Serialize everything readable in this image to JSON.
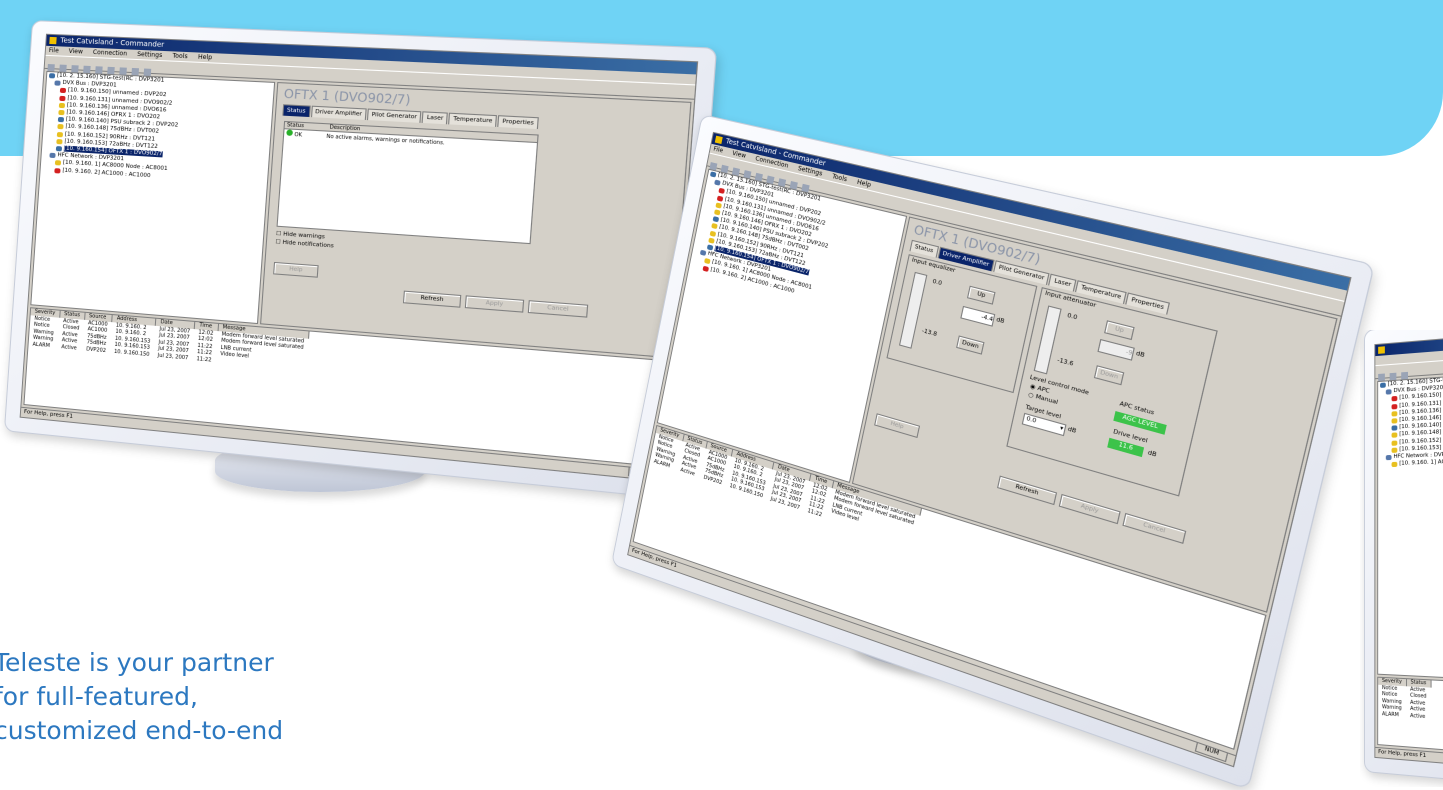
{
  "tagline": [
    "Teleste is your partner",
    "for full-featured,",
    "customized end-to-end"
  ],
  "colors": {
    "banner": "#6fd3f5",
    "tagline": "#2c78c0"
  },
  "app": {
    "title": "Test CatvIsland - Commander",
    "menu": [
      "File",
      "View",
      "Connection",
      "Settings",
      "Tools",
      "Help"
    ],
    "tree": [
      "[10. 2. 15.160] STG-test(RC : DVP3201",
      "DVX Bus : DVP3201",
      "[10. 9.160.150] unnamed : DVP202",
      "[10. 9.160.131] unnamed : DVO902/2",
      "[10. 9.160.136] unnamed : DVO616",
      "[10. 9.160.146] OFRX 1 : DVO202",
      "[10. 9.160.140] PSU subrack 2 : DVP202",
      "[10. 9.160.148] 75dBHz : DVT002",
      "[10. 9.160.152] 90RHz : DVT121",
      "[10. 9.160.153] 72aBHz : DVT122",
      "[10. 9.160.154] OFTX 1 : DVO902/7",
      "HFC Network : DVP3201",
      "[10. 9.160. 1] AC8000 Node : AC8001",
      "[10. 9.160. 2] AC1000 : AC1000"
    ],
    "panel_title": "OFTX 1 (DVO902/7)",
    "tabs": [
      "Status",
      "Driver Amplifier",
      "Pilot Generator",
      "Laser",
      "Temperature",
      "Properties"
    ],
    "status_columns": [
      "Status",
      "Description"
    ],
    "status_ok": "OK",
    "status_desc": "No active alarms, warnings or notifications.",
    "hide_warnings": "Hide warnings",
    "hide_notifications": "Hide notifications",
    "buttons": {
      "help": "Help",
      "refresh": "Refresh",
      "apply": "Apply",
      "cancel": "Cancel",
      "up": "Up",
      "down": "Down"
    },
    "amp": {
      "input_equalizer": "Input equalizer",
      "input_attenuator": "Input attenuator",
      "eq_top": "0.0",
      "eq_value": "-4.4",
      "eq_bottom": "-13.8",
      "att_top": "0.0",
      "att_value": "-9",
      "att_bottom": "-13.6",
      "unit_db": "dB",
      "level_mode": "Level control mode",
      "apc": "APC",
      "manual": "Manual",
      "apc_status_label": "APC status",
      "apc_status_value": "AGC LEVEL",
      "target_level": "Target level",
      "target_value": "0.0",
      "drive_level": "Drive level",
      "drive_value": "11.6"
    },
    "log_headers": [
      "Severity",
      "Status",
      "Source",
      "Address",
      "Date",
      "Time",
      "Message"
    ],
    "log_rows": [
      [
        "Notice",
        "Active",
        "AC1000",
        "10. 9.160. 2",
        "Jul 23, 2007",
        "12:02",
        "Modem forward level saturated"
      ],
      [
        "Notice",
        "Closed",
        "AC1000",
        "10. 9.160. 2",
        "Jul 23, 2007",
        "12:02",
        "Modem forward level saturated"
      ],
      [
        "Warning",
        "Active",
        "75dBHz",
        "10. 9.160.153",
        "Jul 23, 2007",
        "11:22",
        "LNB current"
      ],
      [
        "Warning",
        "Active",
        "75dBHz",
        "10. 9.160.153",
        "Jul 23, 2007",
        "11:22",
        "Video level"
      ],
      [
        "ALARM",
        "Active",
        "DVP202",
        "10. 9.160.150",
        "Jul 23, 2007",
        "11:22",
        ""
      ]
    ],
    "status_bar": "For Help, press F1",
    "num": "NUM"
  }
}
